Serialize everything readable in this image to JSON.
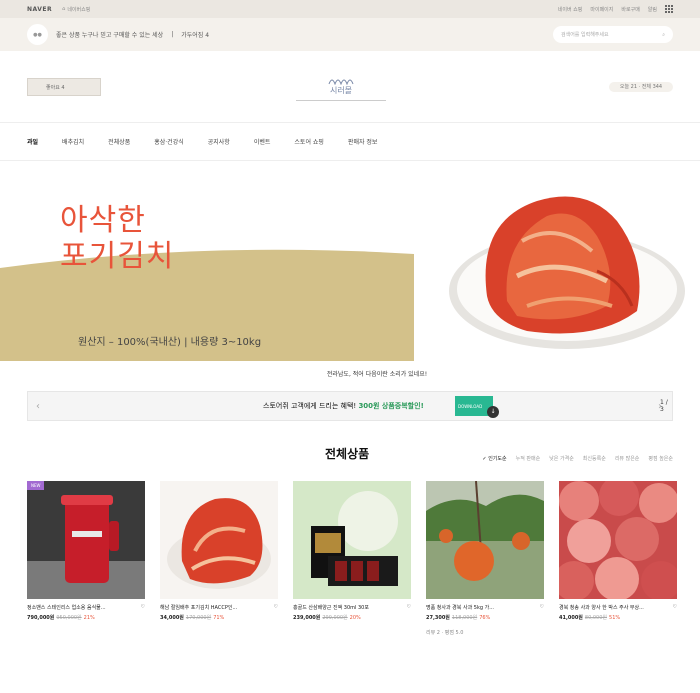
{
  "topbar": {
    "naver": "NAVER",
    "store": "네이버쇼핑",
    "links": [
      "네이버 쇼핑",
      "마이페이지",
      "바로구매",
      "알림"
    ]
  },
  "notice": {
    "text": "좋은 상품 누구나 믿고 구매할 수 있는 세상",
    "extra": "가두어짐 4",
    "search_placeholder": "검색어를 입력해주세요"
  },
  "header": {
    "like_label": "좋아요 4",
    "logo": "시러몰",
    "stats": "오늘 21 · 전체 344"
  },
  "nav": [
    "과일",
    "배추김치",
    "전체상품",
    "홍삼·건강식",
    "공지사항",
    "이벤트",
    "스토어 쇼핑",
    "판매자 정보"
  ],
  "banner": {
    "title1": "아삭한",
    "title2": "포기김치",
    "origin": "원산지 – 100%(국내산)    |  내용량 3~10kg"
  },
  "caption": "전라남도, 적어 다음이란 소리가 있네요!",
  "promo": {
    "text_prefix": "스토어쥐 고객에게 드리는 혜택!",
    "text_highlight": "300원 상품중복할인!",
    "coupon": "DOWNLOAD",
    "page": "1 / 3"
  },
  "section": {
    "title": "전체상품",
    "sorts": [
      "✓ 인기도순",
      "누적 판매순",
      "낮은 가격순",
      "최신등록순",
      "리뷰 많은순",
      "평점 높은순"
    ]
  },
  "products": [
    {
      "title": "정소밴스 스테인리스 업소용 음식물...",
      "price": "790,000원",
      "old": "950,000원",
      "discount": "21%",
      "badge": "NEW"
    },
    {
      "title": "해남 절임배추 포기김치 HACCP인...",
      "price": "34,000원",
      "old": "170,000원",
      "discount": "71%"
    },
    {
      "title": "홍골드 산삼배양근 진액 30ml 30포",
      "price": "239,000원",
      "old": "299,000원",
      "discount": "20%"
    },
    {
      "title": "명품 청사과 경북 사과 5kg 가...",
      "price": "27,300원",
      "old": "118,000원",
      "discount": "76%",
      "review": "리뷰 2 · 평점 5.0"
    },
    {
      "title": "경북 청송 사과 양사 한 박스 주사 부상...",
      "price": "41,000원",
      "old": "80,000원",
      "discount": "51%"
    }
  ],
  "colors": {
    "accent": "#e8543a",
    "banner_yellow": "#d3c18a",
    "coupon": "#29b892"
  }
}
